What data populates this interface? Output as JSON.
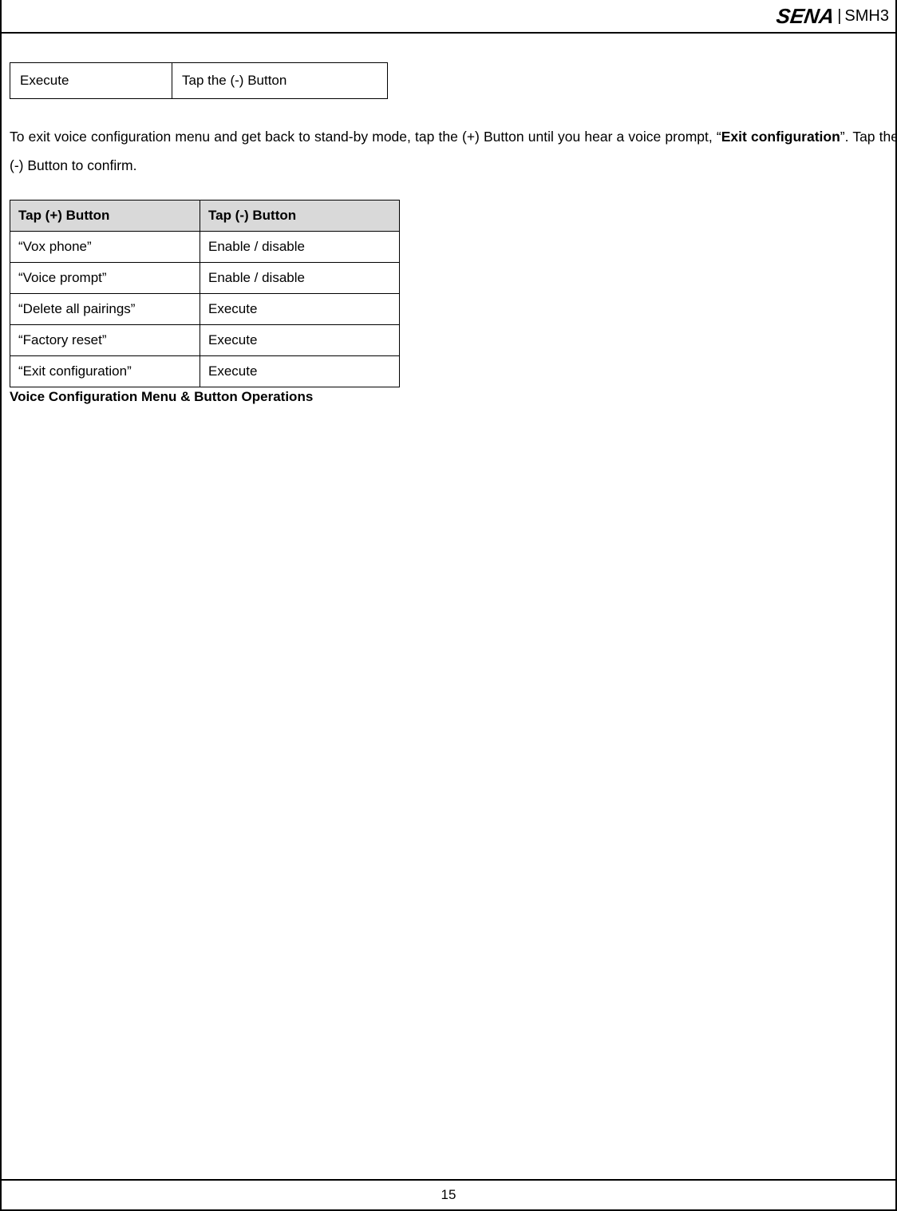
{
  "header": {
    "brand": "SENA",
    "separator": "|",
    "model": "SMH3"
  },
  "small_table": {
    "left": "Execute",
    "right": "Tap the (-) Button"
  },
  "paragraph": {
    "part1": "To exit voice configuration menu and get back to stand-by mode, tap the (+) Button until you hear a voice prompt, “",
    "bold": "Exit configuration",
    "part2": "”. Tap the (-) Button to confirm."
  },
  "config_table": {
    "headers": [
      "Tap (+) Button",
      "Tap (-) Button"
    ],
    "rows": [
      [
        "“Vox phone”",
        "Enable / disable"
      ],
      [
        "“Voice prompt”",
        "Enable / disable"
      ],
      [
        "“Delete all pairings”",
        "Execute"
      ],
      [
        "“Factory reset”",
        "Execute"
      ],
      [
        "“Exit configuration”",
        "Execute"
      ]
    ]
  },
  "caption": "Voice Configuration Menu & Button Operations",
  "page_number": "15"
}
